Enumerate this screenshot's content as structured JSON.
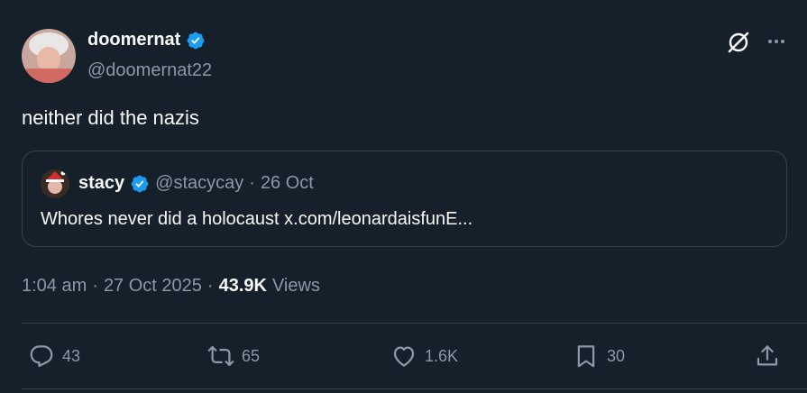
{
  "tweet": {
    "display_name": "doomernat",
    "handle": "@doomernat22",
    "text": "neither did the nazis",
    "time": "1:04 am",
    "sep1": "·",
    "date": "27 Oct 2025",
    "sep2": "·",
    "views_count": "43.9K",
    "views_label": "Views"
  },
  "quote": {
    "display_name": "stacy",
    "handle": "@stacycay",
    "sep": "·",
    "date": "26 Oct",
    "text": "Whores never did a holocaust x.com/leonardaisfunE..."
  },
  "actions": {
    "replies": "43",
    "reposts": "65",
    "likes": "1.6K",
    "bookmarks": "30"
  },
  "colors": {
    "background": "#15202b",
    "verified": "#1d9bf0",
    "muted": "#8b98a5",
    "border": "#38444d"
  },
  "icons": [
    "verified-badge-icon",
    "grok-icon",
    "more-icon",
    "reply-icon",
    "repost-icon",
    "like-icon",
    "bookmark-icon",
    "share-icon"
  ]
}
